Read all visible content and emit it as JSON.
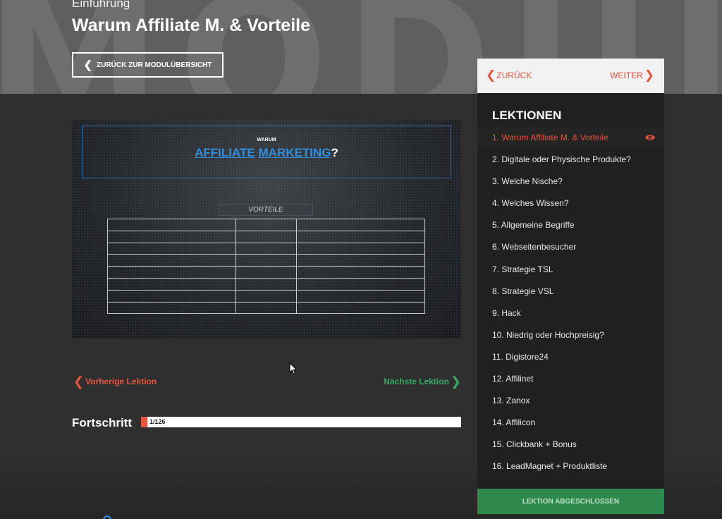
{
  "header": {
    "module_name": "Einführung",
    "lesson_title": "Warum Affiliate M. & Vorteile",
    "back_to_overview": "ZURÜCK ZUR MODULÜBERSICHT",
    "watermark": "MODUL"
  },
  "slide": {
    "small_text": "WARUM",
    "word1": "AFFILIATE",
    "word2": "MARKETING",
    "question_mark": "?",
    "label": "VORTEILE",
    "table_rows": 8,
    "table_cols": 3
  },
  "lesson_nav": {
    "previous": "Vorherige Lektion",
    "next": "Nächste Lektion"
  },
  "progress": {
    "label": "Fortschritt",
    "text": "1/126",
    "current": 1,
    "total": 126
  },
  "sidebar": {
    "nav_back": "ZURÜCK",
    "nav_next": "WEITER",
    "title": "LEKTIONEN",
    "lessons": [
      "1. Warum Affiliate M. & Vorteile",
      "2. Digitale oder Physische Produkte?",
      "3. Welche Nische?",
      "4. Welches Wissen?",
      "5. Allgemeine Begriffe",
      "6. Webseitenbesucher",
      "7. Strategie TSL",
      "8. Strategie VSL",
      "9. Hack",
      "10. Niedrig oder Hochpreisig?",
      "11. Digistore24",
      "12. Affilinet",
      "13. Zanox",
      "14. Affilicon",
      "15. Clickbank + Bonus",
      "16. LeadMagnet + Produktliste"
    ],
    "active_index": 0,
    "complete_button": "LEKTION ABGESCHLOSSEN"
  },
  "colors": {
    "accent_red": "#e8533e",
    "accent_green": "#34a960",
    "button_green": "#2e8a4c",
    "slide_blue": "#2e8fe0"
  },
  "icons": {
    "back": "chevron-left-icon",
    "next": "chevron-right-icon",
    "active_lesson": "eye-icon"
  }
}
